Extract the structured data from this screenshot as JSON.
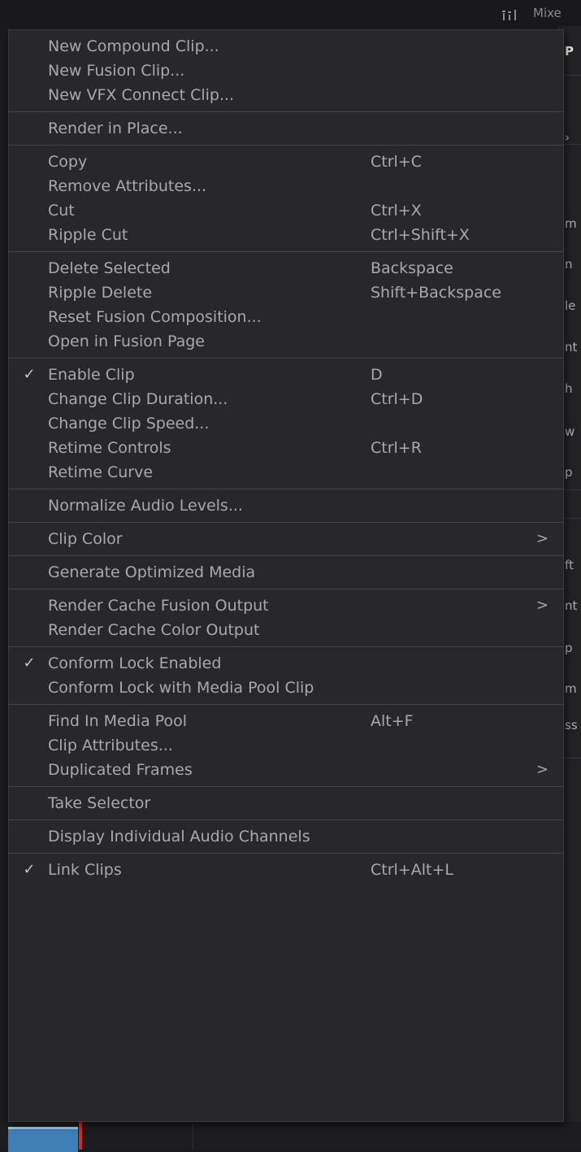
{
  "background": {
    "topbar_label": "Mixe",
    "topbar_icon": "mixer-icon",
    "panel_fragments": [
      {
        "text": "P",
        "bold": true
      },
      {
        "text": "›",
        "bold": false
      },
      {
        "text": "m",
        "bold": false
      },
      {
        "text": "n",
        "bold": false
      },
      {
        "text": "le",
        "bold": false
      },
      {
        "text": "nt",
        "bold": false
      },
      {
        "text": "h",
        "bold": false
      },
      {
        "text": "w",
        "bold": false
      },
      {
        "text": "p",
        "bold": false
      },
      {
        "text": "ft",
        "bold": false
      },
      {
        "text": "nt",
        "bold": false
      },
      {
        "text": "p",
        "bold": false
      },
      {
        "text": "m",
        "bold": false
      },
      {
        "text": "ss",
        "bold": false
      }
    ]
  },
  "menu": {
    "colors": {
      "background": "#28282c",
      "text": "#a9a9ab",
      "separator": "#46464a"
    },
    "groups": [
      [
        {
          "label": "New Compound Clip..."
        },
        {
          "label": "New Fusion Clip..."
        },
        {
          "label": "New VFX Connect Clip..."
        }
      ],
      [
        {
          "label": "Render in Place..."
        }
      ],
      [
        {
          "label": "Copy",
          "shortcut": "Ctrl+C"
        },
        {
          "label": "Remove Attributes..."
        },
        {
          "label": "Cut",
          "shortcut": "Ctrl+X"
        },
        {
          "label": "Ripple Cut",
          "shortcut": "Ctrl+Shift+X"
        }
      ],
      [
        {
          "label": "Delete Selected",
          "shortcut": "Backspace"
        },
        {
          "label": "Ripple Delete",
          "shortcut": "Shift+Backspace"
        },
        {
          "label": "Reset Fusion Composition..."
        },
        {
          "label": "Open in Fusion Page"
        }
      ],
      [
        {
          "label": "Enable Clip",
          "shortcut": "D",
          "checked": true
        },
        {
          "label": "Change Clip Duration...",
          "shortcut": "Ctrl+D"
        },
        {
          "label": "Change Clip Speed..."
        },
        {
          "label": "Retime Controls",
          "shortcut": "Ctrl+R"
        },
        {
          "label": "Retime Curve"
        }
      ],
      [
        {
          "label": "Normalize Audio Levels..."
        }
      ],
      [
        {
          "label": "Clip Color",
          "submenu": true
        }
      ],
      [
        {
          "label": "Generate Optimized Media"
        }
      ],
      [
        {
          "label": "Render Cache Fusion Output",
          "submenu": true
        },
        {
          "label": "Render Cache Color Output"
        }
      ],
      [
        {
          "label": "Conform Lock Enabled",
          "checked": true
        },
        {
          "label": "Conform Lock with Media Pool Clip"
        }
      ],
      [
        {
          "label": "Find In Media Pool",
          "shortcut": "Alt+F"
        },
        {
          "label": "Clip Attributes..."
        },
        {
          "label": "Duplicated Frames",
          "submenu": true
        }
      ],
      [
        {
          "label": "Take Selector"
        }
      ],
      [
        {
          "label": "Display Individual Audio Channels"
        }
      ],
      [
        {
          "label": "Link Clips",
          "shortcut": "Ctrl+Alt+L",
          "checked": true
        }
      ]
    ],
    "check_glyph": "✓",
    "submenu_glyph": ">"
  }
}
